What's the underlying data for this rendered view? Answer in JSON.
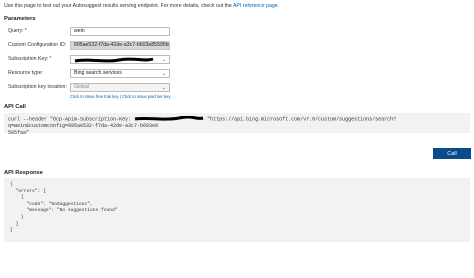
{
  "intro": {
    "text": "Use this page to test out your Autosuggest results serving endpoint. For more details, check out the",
    "link": "API reference page."
  },
  "parameters": {
    "title": "Parameters",
    "query": {
      "label": "Query:",
      "value": "wein"
    },
    "custom_config": {
      "label": "Custom Configuration ID:",
      "value": "895ae532-f7da-42de-a3c7-b603e85595faa"
    },
    "subscription_key": {
      "label": "Subscription Key:",
      "value": ""
    },
    "resource_type": {
      "label": "Resource type:",
      "value": "Bing search services"
    },
    "key_location": {
      "label": "Subscription key location:",
      "value": "Global"
    },
    "links": {
      "issue_free_key": "Click to issue free trial key",
      "separator": " | ",
      "issue_paid_key": "Click to issue paid tier key"
    }
  },
  "api_call": {
    "title": "API Call",
    "prefix": "curl --header \"Ocp-Apim-Subscription-Key:",
    "suffix": "\"https://api.bing.microsoft.com/v7.0/custom/suggestions/search?q=wein&customconfig=895ae532-f7da-42de-a3c7-b603e8",
    "line2": "595faa\""
  },
  "call_button": {
    "label": "Call"
  },
  "api_response": {
    "title": "API Response",
    "body": "{\n  \"errors\": [\n    {\n      \"code\": \"NoSuggestions\",\n      \"message\": \"No suggestions found\"\n    }\n  ]\n}"
  },
  "icons": {
    "dropdown": "chevron-down-icon"
  },
  "colors": {
    "link": "#0067b8",
    "button": "#0b4a8b",
    "required": "#cc0000",
    "box_bg": "#f2f2f2"
  }
}
